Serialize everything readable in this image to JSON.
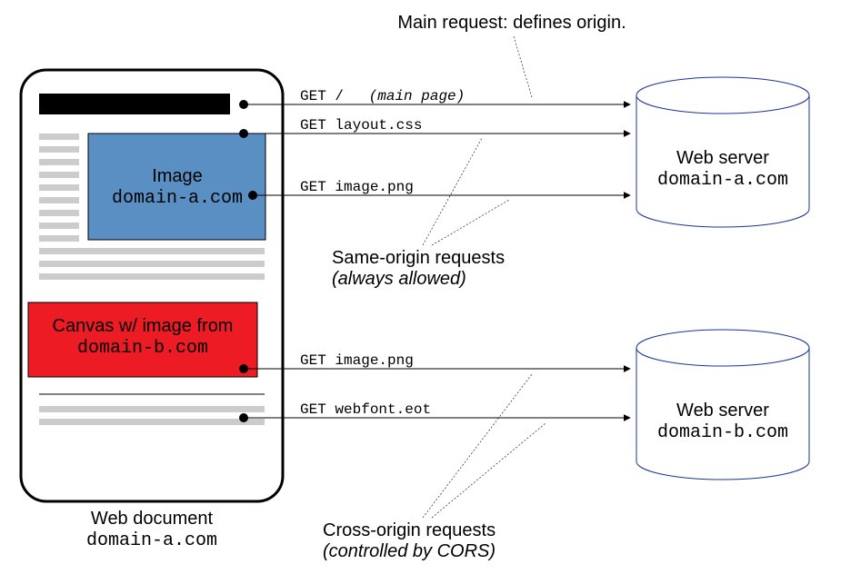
{
  "header": {
    "main_request_label": "Main request: defines origin."
  },
  "doc": {
    "image_label": "Image",
    "image_domain": "domain-a.com",
    "canvas_label_1": "Canvas w/ image from",
    "canvas_label_2": "domain-b.com",
    "caption_title": "Web document",
    "caption_domain": "domain-a.com"
  },
  "requests": {
    "r1": {
      "method": "GET",
      "path": "/",
      "note": "(main page)"
    },
    "r2": {
      "method": "GET",
      "path": "layout.css"
    },
    "r3": {
      "method": "GET",
      "path": "image.png"
    },
    "r4": {
      "method": "GET",
      "path": "image.png"
    },
    "r5": {
      "method": "GET",
      "path": "webfont.eot"
    }
  },
  "annotations": {
    "same_origin_l1": "Same-origin requests",
    "same_origin_l2": "(always allowed)",
    "cross_origin_l1": "Cross-origin requests",
    "cross_origin_l2": "(controlled by CORS)"
  },
  "servers": {
    "a": {
      "title": "Web server",
      "domain": "domain-a.com"
    },
    "b": {
      "title": "Web server",
      "domain": "domain-b.com"
    }
  }
}
